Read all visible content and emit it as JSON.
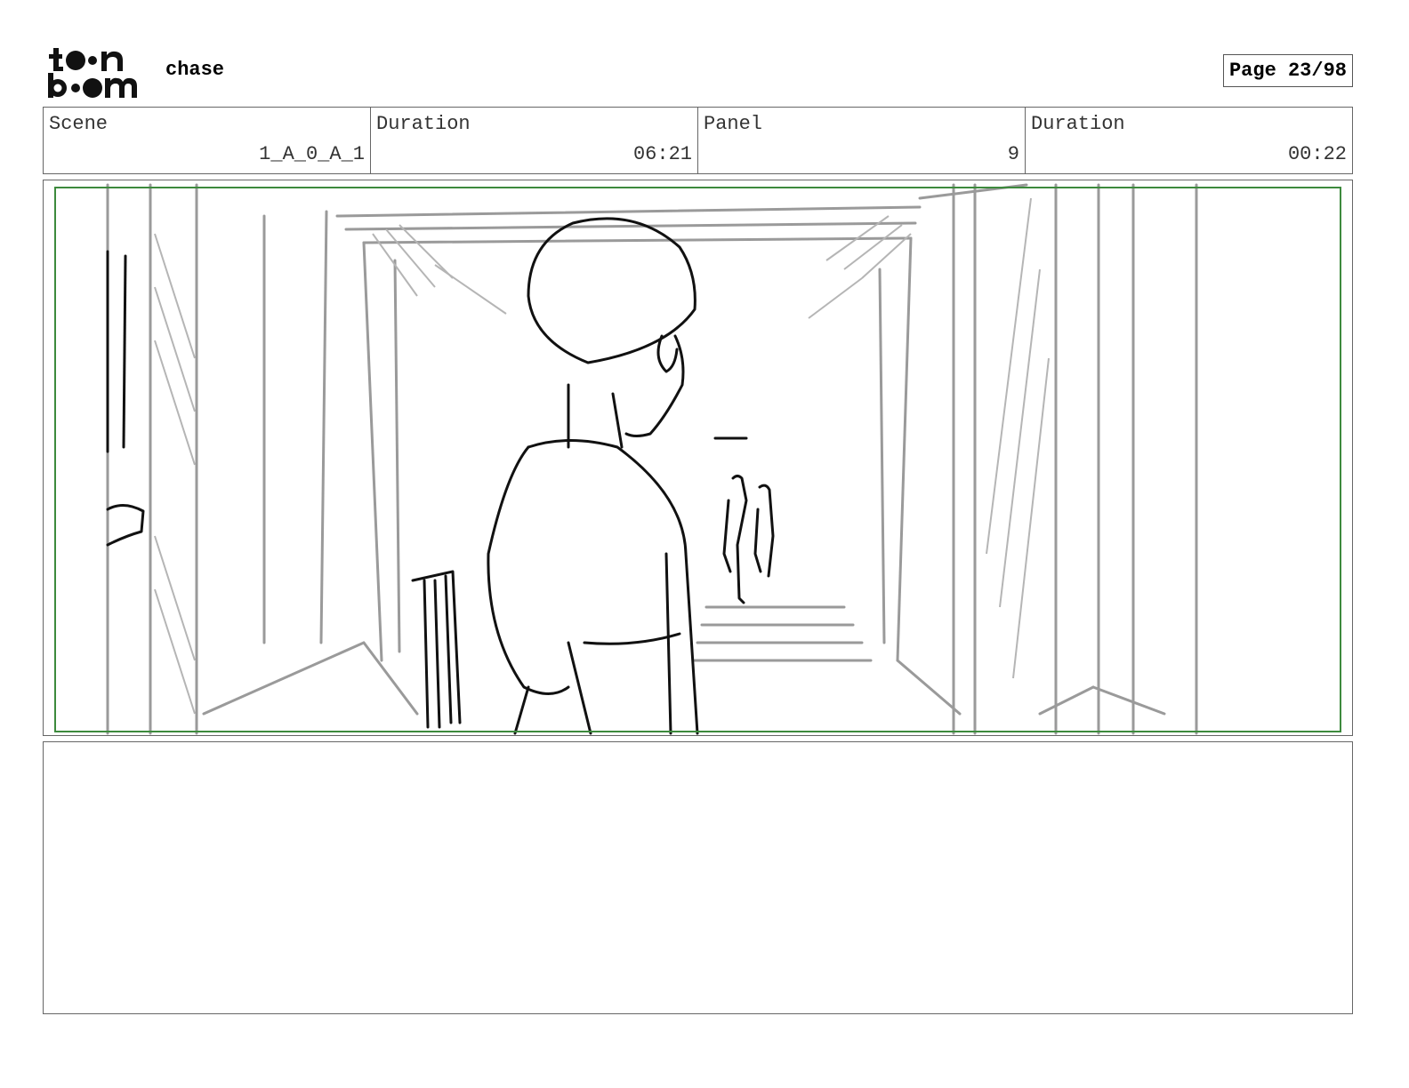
{
  "header": {
    "project_title": "chase",
    "page_indicator": "Page 23/98",
    "logo_text": "toon boom"
  },
  "info": {
    "scene_label": "Scene",
    "scene_value": "1_A_0_A_1",
    "scene_duration_label": "Duration",
    "scene_duration_value": "06:21",
    "panel_label": "Panel",
    "panel_value": "9",
    "panel_duration_label": "Duration",
    "panel_duration_value": "00:22"
  },
  "colors": {
    "safe_area": "#3d8a3d",
    "sketch_dark": "#111111",
    "sketch_light": "#9a9a9a"
  }
}
